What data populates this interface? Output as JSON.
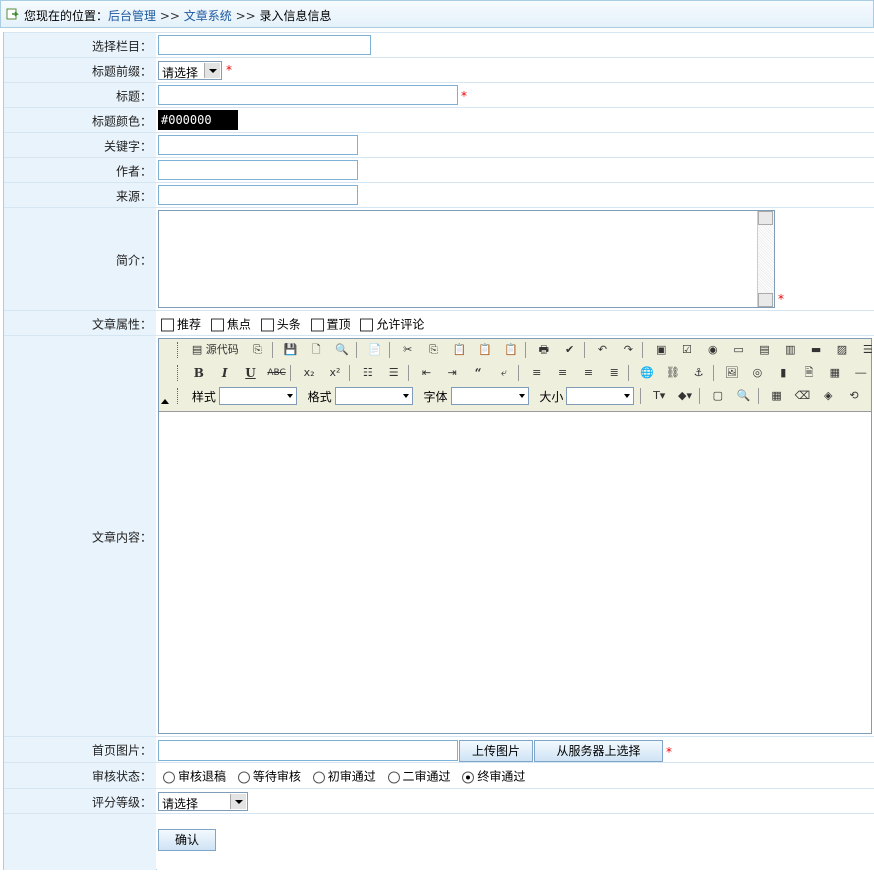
{
  "breadcrumb": {
    "prefix": "您现在的位置：",
    "home": "后台管理",
    "sep1": " >> ",
    "section": "文章系统",
    "sep2": " >> ",
    "current": "录入信息信息"
  },
  "form": {
    "column": {
      "label": "选择栏目：",
      "value": ""
    },
    "prefix": {
      "label": "标题前缀：",
      "selected": "请选择",
      "required": "*"
    },
    "title": {
      "label": "标题：",
      "value": "",
      "required": "*"
    },
    "color": {
      "label": "标题颜色：",
      "value": "#000000"
    },
    "keywords": {
      "label": "关键字：",
      "value": ""
    },
    "author": {
      "label": "作者：",
      "value": ""
    },
    "source": {
      "label": "来源：",
      "value": ""
    },
    "summary": {
      "label": "简介：",
      "value": "",
      "required": "*"
    },
    "attributes": {
      "label": "文章属性：",
      "options": [
        "推荐",
        "焦点",
        "头条",
        "置顶",
        "允许评论"
      ]
    },
    "content": {
      "label": "文章内容：",
      "source_button": "源代码",
      "style_label": "样式",
      "format_label": "格式",
      "font_label": "字体",
      "size_label": "大小"
    },
    "image": {
      "label": "首页图片：",
      "value": "",
      "upload": "上传图片",
      "server": "从服务器上选择",
      "required": "*"
    },
    "status": {
      "label": "审核状态：",
      "options": [
        "审核退稿",
        "等待审核",
        "初审通过",
        "二审通过",
        "终审通过"
      ],
      "selected": "终审通过"
    },
    "rating": {
      "label": "评分等级：",
      "selected": "请选择"
    },
    "submit": "确认"
  }
}
